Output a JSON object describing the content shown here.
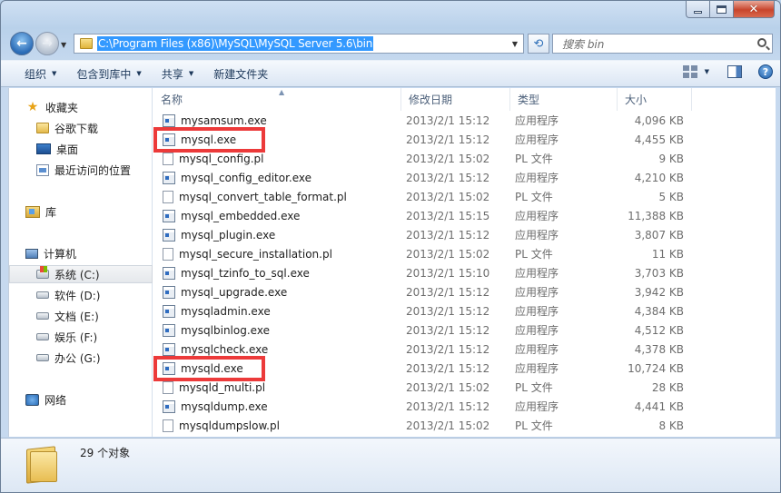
{
  "address": {
    "path": "C:\\Program Files (x86)\\MySQL\\MySQL Server 5.6\\bin",
    "search_placeholder": "搜索 bin"
  },
  "toolbar": {
    "organize": "组织",
    "include_in_library": "包含到库中",
    "share": "共享",
    "new_folder": "新建文件夹"
  },
  "nav": {
    "favorites": "收藏夹",
    "downloads": "谷歌下载",
    "desktop": "桌面",
    "recent": "最近访问的位置",
    "libraries": "库",
    "computer": "计算机",
    "drive_c": "系统 (C:)",
    "drive_d": "软件 (D:)",
    "drive_e": "文档 (E:)",
    "drive_f": "娱乐 (F:)",
    "drive_g": "办公 (G:)",
    "network": "网络"
  },
  "columns": {
    "name": "名称",
    "date": "修改日期",
    "type": "类型",
    "size": "大小"
  },
  "files": [
    {
      "name": "mysamsum.exe",
      "date": "2013/2/1 15:12",
      "type": "应用程序",
      "size": "4,096 KB",
      "kind": "exe"
    },
    {
      "name": "mysql.exe",
      "date": "2013/2/1 15:12",
      "type": "应用程序",
      "size": "4,455 KB",
      "kind": "exe"
    },
    {
      "name": "mysql_config.pl",
      "date": "2013/2/1 15:02",
      "type": "PL 文件",
      "size": "9 KB",
      "kind": "pl"
    },
    {
      "name": "mysql_config_editor.exe",
      "date": "2013/2/1 15:12",
      "type": "应用程序",
      "size": "4,210 KB",
      "kind": "exe"
    },
    {
      "name": "mysql_convert_table_format.pl",
      "date": "2013/2/1 15:02",
      "type": "PL 文件",
      "size": "5 KB",
      "kind": "pl"
    },
    {
      "name": "mysql_embedded.exe",
      "date": "2013/2/1 15:15",
      "type": "应用程序",
      "size": "11,388 KB",
      "kind": "exe"
    },
    {
      "name": "mysql_plugin.exe",
      "date": "2013/2/1 15:12",
      "type": "应用程序",
      "size": "3,807 KB",
      "kind": "exe"
    },
    {
      "name": "mysql_secure_installation.pl",
      "date": "2013/2/1 15:02",
      "type": "PL 文件",
      "size": "11 KB",
      "kind": "pl"
    },
    {
      "name": "mysql_tzinfo_to_sql.exe",
      "date": "2013/2/1 15:10",
      "type": "应用程序",
      "size": "3,703 KB",
      "kind": "exe"
    },
    {
      "name": "mysql_upgrade.exe",
      "date": "2013/2/1 15:12",
      "type": "应用程序",
      "size": "3,942 KB",
      "kind": "exe"
    },
    {
      "name": "mysqladmin.exe",
      "date": "2013/2/1 15:12",
      "type": "应用程序",
      "size": "4,384 KB",
      "kind": "exe"
    },
    {
      "name": "mysqlbinlog.exe",
      "date": "2013/2/1 15:12",
      "type": "应用程序",
      "size": "4,512 KB",
      "kind": "exe"
    },
    {
      "name": "mysqlcheck.exe",
      "date": "2013/2/1 15:12",
      "type": "应用程序",
      "size": "4,378 KB",
      "kind": "exe"
    },
    {
      "name": "mysqld.exe",
      "date": "2013/2/1 15:12",
      "type": "应用程序",
      "size": "10,724 KB",
      "kind": "exe"
    },
    {
      "name": "mysqld_multi.pl",
      "date": "2013/2/1 15:02",
      "type": "PL 文件",
      "size": "28 KB",
      "kind": "pl"
    },
    {
      "name": "mysqldump.exe",
      "date": "2013/2/1 15:12",
      "type": "应用程序",
      "size": "4,441 KB",
      "kind": "exe"
    },
    {
      "name": "mysqldumpslow.pl",
      "date": "2013/2/1 15:02",
      "type": "PL 文件",
      "size": "8 KB",
      "kind": "pl"
    }
  ],
  "status": {
    "item_count": "29 个对象"
  }
}
